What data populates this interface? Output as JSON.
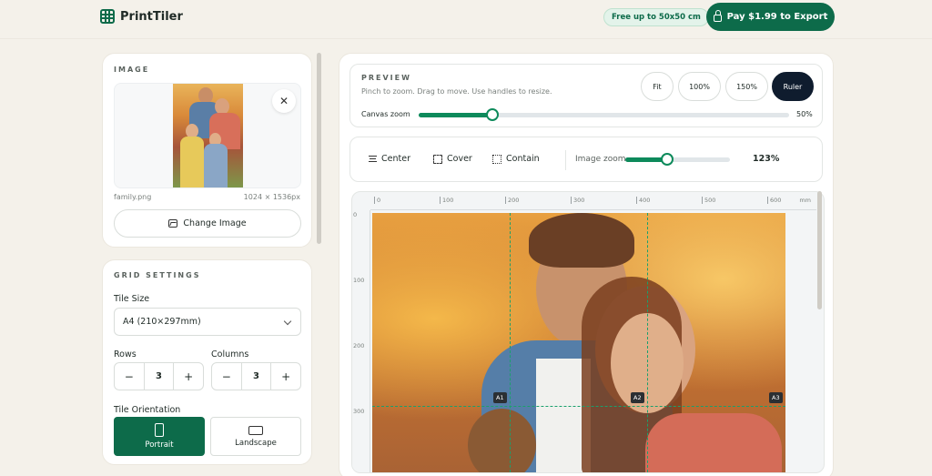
{
  "app": {
    "name": "PrintTiler",
    "free_badge": "Free up to 50x50 cm",
    "pay_button": "Pay $1.99 to Export"
  },
  "image_panel": {
    "title": "IMAGE",
    "file_name": "family.png",
    "file_size": "1024 × 1536px",
    "change_button": "Change Image",
    "close_symbol": "✕"
  },
  "grid_settings": {
    "title": "GRID SETTINGS",
    "tile_size_label": "Tile Size",
    "tile_size_value": "A4 (210×297mm)",
    "rows_label": "Rows",
    "rows_value": "3",
    "columns_label": "Columns",
    "columns_value": "3",
    "minus": "−",
    "plus": "+",
    "orientation_label": "Tile Orientation",
    "portrait_label": "Portrait",
    "landscape_label": "Landscape"
  },
  "preview": {
    "title": "PREVIEW",
    "hint": "Pinch to zoom. Drag to move. Use handles to resize.",
    "buttons": [
      "Fit",
      "100%",
      "150%",
      "Ruler"
    ],
    "active_button": "Ruler",
    "canvas_zoom_label": "Canvas zoom",
    "canvas_zoom_value": "50%",
    "canvas_zoom_fraction": 0.2
  },
  "tools": {
    "center": "Center",
    "cover": "Cover",
    "contain": "Contain",
    "image_zoom_label": "Image zoom",
    "image_zoom_value": "123%",
    "image_zoom_fraction": 0.4
  },
  "ruler": {
    "unit": "mm",
    "top_ticks": [
      "0",
      "100",
      "200",
      "300",
      "400",
      "500",
      "600"
    ],
    "left_ticks": [
      "0",
      "100",
      "200",
      "300"
    ]
  },
  "tiles": [
    "A1",
    "A2",
    "A3"
  ],
  "colors": {
    "brand": "#0d6b4a",
    "accent_slider": "#0d8a5b",
    "ruler_active": "#0f1c2e"
  }
}
